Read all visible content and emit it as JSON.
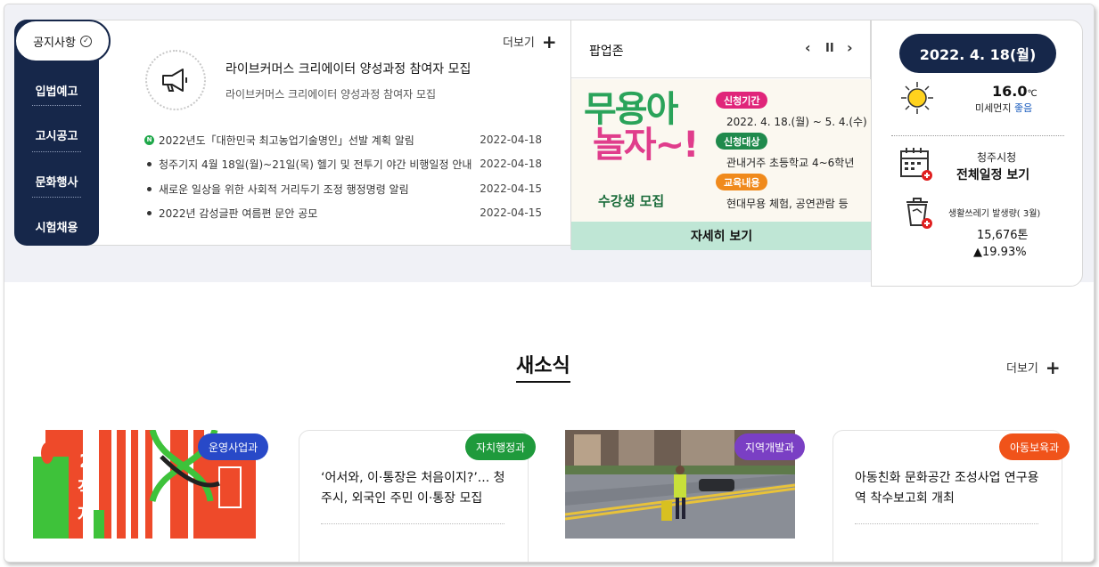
{
  "notice": {
    "tabs": [
      "공지사항",
      "입법예고",
      "고시공고",
      "문화행사",
      "시험채용"
    ],
    "more_label": "더보기",
    "featured": {
      "title": "라이브커머스 크리에이터 양성과정 참여자 모집",
      "subtitle": "라이브커머스 크리에이터 양성과정 참여자 모집"
    },
    "new_badge": "N",
    "items": [
      {
        "title": "2022년도「대한민국 최고농업기술명인」선발 계획 알림",
        "date": "2022-04-18"
      },
      {
        "title": "청주기지 4월 18일(월)~21일(목) 헬기 및 전투기 야간 비행일정 안내",
        "date": "2022-04-18"
      },
      {
        "title": "새로운 일상을 위한 사회적 거리두기 조정 행정명령 알림",
        "date": "2022-04-15"
      },
      {
        "title": "2022년 감성글판 여름편 문안 공모",
        "date": "2022-04-15"
      }
    ]
  },
  "popup": {
    "title": "팝업존",
    "controls": {
      "prev": "‹",
      "pause": "II",
      "next": "›"
    },
    "banner": {
      "logo_line1": "무용아",
      "logo_line2": "놀자~!",
      "recruit": "수강생 모집",
      "rows": [
        {
          "tag": "신청기간",
          "text": "2022. 4. 18.(월) ~ 5. 4.(수)",
          "color": "#e0257a"
        },
        {
          "tag": "신청대상",
          "text": "관내거주 초등학교 4~6학년",
          "color": "#1f8a4c"
        },
        {
          "tag": "교육내용",
          "text": "현대무용 체험, 공연관람 등",
          "color": "#f08a1c"
        }
      ]
    },
    "detail_button": "자세히 보기"
  },
  "info": {
    "date": "2022. 4. 18(월)",
    "temperature": "16.0",
    "temp_unit": "℃",
    "dust_label": "미세먼지",
    "dust_status": "좋음",
    "calendar_line1": "청주시청",
    "calendar_line2": "전체일정 보기",
    "trash_label": "생활쓰레기 발생량( 3월)",
    "trash_amount": "15,676톤",
    "trash_change": "▲19.93%"
  },
  "news": {
    "title": "새소식",
    "more_label": "더보기",
    "cards": [
      {
        "dept": "운영사업과",
        "color": "#2849c8",
        "text": ""
      },
      {
        "dept": "자치행정과",
        "color": "#1f9a3c",
        "text": "‘어서와, 이·통장은 처음이지?’... 청주시, 외국인 주민 이·통장 모집"
      },
      {
        "dept": "지역개발과",
        "color": "#7a3fc4",
        "text": ""
      },
      {
        "dept": "아동보육과",
        "color": "#f0531a",
        "text": "아동친화 문화공간 조성사업 연구용역 착수보고회 개최"
      }
    ],
    "poster_text": [
      "2",
      "직",
      "지"
    ]
  }
}
